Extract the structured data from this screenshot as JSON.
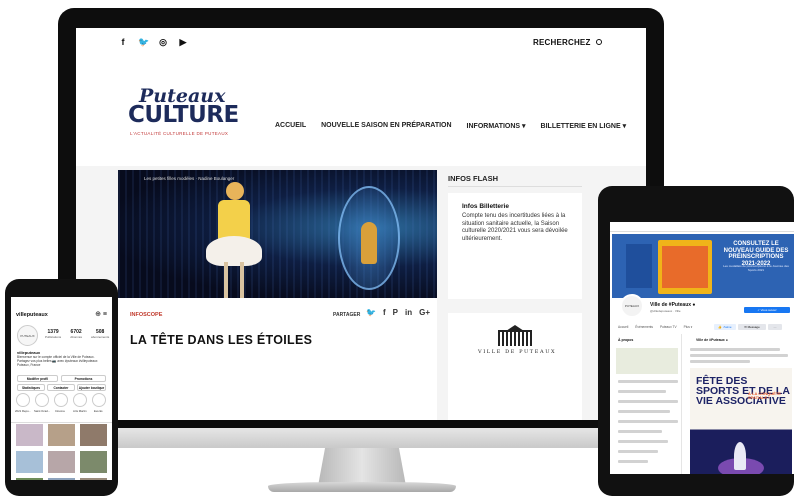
{
  "website": {
    "social_icons": [
      "f",
      "🐦",
      "◎",
      "▶"
    ],
    "search_label": "RECHERCHEZ",
    "logo": {
      "line1": "Puteaux",
      "line2": "CULTURE",
      "tagline": "L'ACTUALITÉ CULTURELLE DE PUTEAUX"
    },
    "nav": [
      "ACCUEIL",
      "NOUVELLE SAISON EN PRÉPARATION",
      "INFORMATIONS ▾",
      "BILLETTERIE EN LIGNE ▾"
    ],
    "hero_caption": "Les petites filles modèles · Nadine Boulanger",
    "article": {
      "category": "INFOSCOPE",
      "share_label": "PARTAGER",
      "share_icons": [
        "🐦",
        "f",
        "P",
        "in",
        "G+"
      ],
      "headline": "LA TÊTE DANS LES ÉTOILES"
    },
    "flash": {
      "title": "INFOS FLASH",
      "item_title": "Infos Billetterie",
      "item_text": "Compte tenu des incertitudes liées à la situation sanitaire actuelle, la Saison culturelle 2020/2021 vous sera dévoilée ultérieurement."
    },
    "ville_label": "VILLE DE PUTEAUX"
  },
  "instagram": {
    "username": "villeputeaux",
    "header_icons": "⊕ ≡",
    "avatar_text": "PUTEAUX",
    "stats": [
      {
        "value": "1379",
        "label": "Publications"
      },
      {
        "value": "6702",
        "label": "Abonnés"
      },
      {
        "value": "508",
        "label": "abonnements"
      }
    ],
    "name": "villeputeaux",
    "bio": "Bienvenue sur le compte officiel de la Ville de Puteaux. Partagez vos plus belles 📷 avec #puteaux #villeputeaux Puteaux, France",
    "buttons": [
      "Modifier profil",
      "Promotions",
      "Statistiques",
      "Contacter",
      "Ajouter boutique"
    ],
    "highlights": [
      "2021 Repu...",
      "Saint Ocad...",
      "Cinéma",
      "Arts Martin",
      "Events"
    ],
    "grid_colors": [
      "#c9b8c8",
      "#b6a089",
      "#8f7a6a",
      "#a7c0d8",
      "#b7a6a8",
      "#7c8a6b",
      "#6e8c5a",
      "#8ea3bd",
      "#9a8c7c"
    ]
  },
  "facebook": {
    "cover": {
      "headline": "CONSULTEZ LE NOUVEAU GUIDE DES PRÉINSCRIPTIONS 2021-2022",
      "subline": "Les modalités de préinscriptions à la Journée des Sports 2021"
    },
    "avatar_text": "PUTEAUX",
    "page_name": "Ville de #Puteaux ●",
    "page_sub": "@villedeputeaux · Ville",
    "primary_button": "✓ Vous suivez",
    "tabs": [
      "Accueil",
      "Événements",
      "Puteaux TV",
      "Plus ▾"
    ],
    "actions": [
      "👍 J'aime",
      "✉ Message",
      "···"
    ],
    "about": "À propos",
    "post_author": "Ville de #Puteaux ●",
    "poster": {
      "title": "FÊTE DES SPORTS ET DE LA VIE ASSOCIATIVE",
      "tag": "À LA CONQUÊTE SPATIALE !"
    }
  }
}
